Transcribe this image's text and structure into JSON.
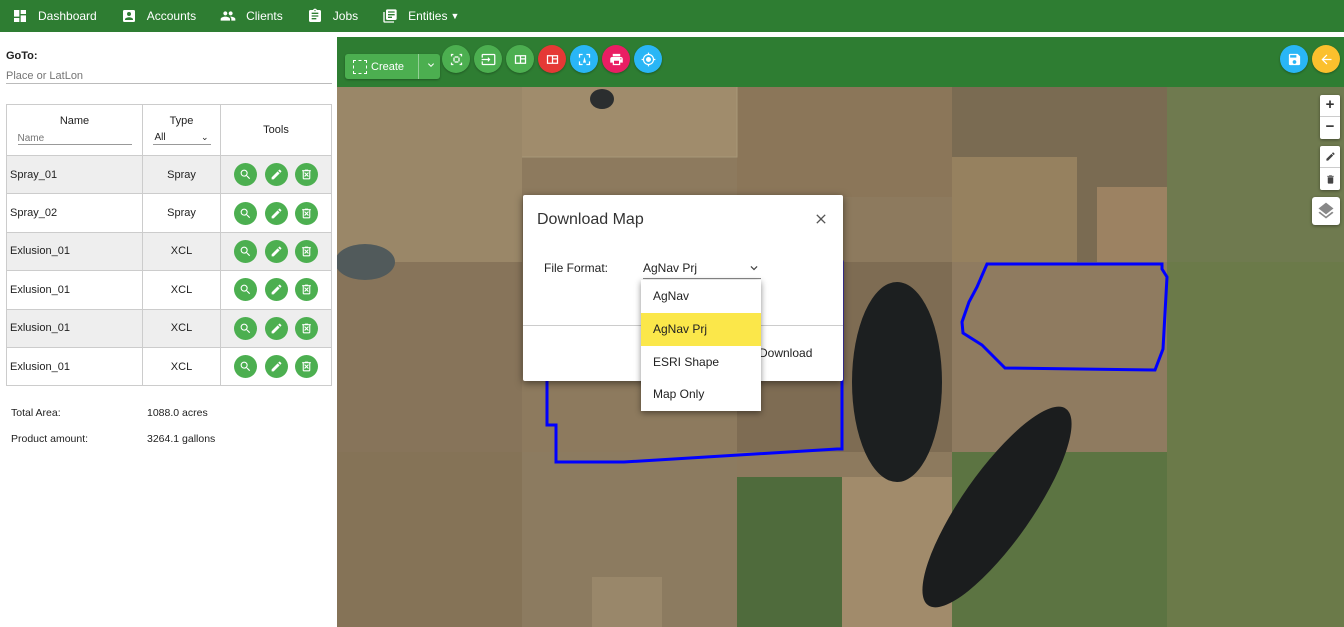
{
  "navbar": {
    "items": [
      {
        "label": "Dashboard",
        "icon": "dashboard-icon"
      },
      {
        "label": "Accounts",
        "icon": "account-box-icon"
      },
      {
        "label": "Clients",
        "icon": "people-icon"
      },
      {
        "label": "Jobs",
        "icon": "clipboard-icon"
      },
      {
        "label": "Entities",
        "icon": "library-books-icon"
      }
    ],
    "color": "#2e7d32"
  },
  "sidebar": {
    "goto_label": "GoTo:",
    "goto_placeholder": "Place or LatLon",
    "table": {
      "headers": {
        "name": "Name",
        "type": "Type",
        "tools": "Tools"
      },
      "name_filter_placeholder": "Name",
      "type_filter_value": "All",
      "rows": [
        {
          "name": "Spray_01",
          "type": "Spray"
        },
        {
          "name": "Spray_02",
          "type": "Spray"
        },
        {
          "name": "Exlusion_01",
          "type": "XCL"
        },
        {
          "name": "Exlusion_01",
          "type": "XCL"
        },
        {
          "name": "Exlusion_01",
          "type": "XCL"
        },
        {
          "name": "Exlusion_01",
          "type": "XCL"
        }
      ]
    },
    "summary": {
      "total_area_label": "Total Area:",
      "total_area_value": "1088.0 acres",
      "product_label": "Product amount:",
      "product_value": "3264.1 gallons"
    }
  },
  "toolbar": {
    "create_label": "Create",
    "buttons": [
      {
        "icon": "select-area-icon",
        "color": "#4caf50"
      },
      {
        "icon": "import-icon",
        "color": "#4caf50"
      },
      {
        "icon": "split-view-icon",
        "color": "#4caf50"
      },
      {
        "icon": "split-view-red-icon",
        "color": "#e53935"
      },
      {
        "icon": "text-box-icon",
        "color": "#29b6f6"
      },
      {
        "icon": "print-icon",
        "color": "#e91e63"
      },
      {
        "icon": "target-icon",
        "color": "#29b6f6"
      }
    ],
    "save_color": "#29b6f6",
    "back_color": "#fbc02d"
  },
  "map": {
    "zoom_in": "+",
    "zoom_out": "−",
    "boundary_color": "#0000ff"
  },
  "dialog": {
    "title": "Download Map",
    "file_format_label": "File Format:",
    "file_format_value": "AgNav Prj",
    "download_label": "Download",
    "options": [
      "AgNav",
      "AgNav Prj",
      "ESRI Shape",
      "Map Only"
    ],
    "selected_index": 1,
    "highlight_color": "#fbe74a"
  }
}
